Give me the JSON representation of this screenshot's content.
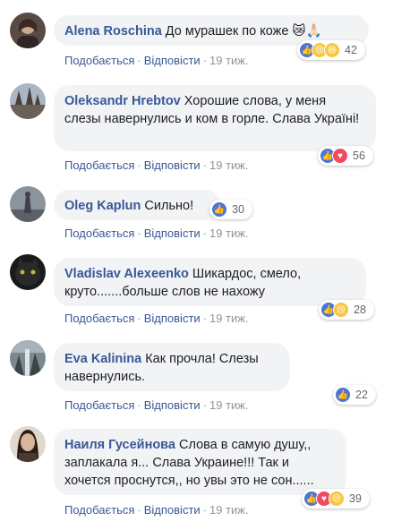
{
  "comments": [
    {
      "author": "Alena Roschina",
      "text": "До мурашек по коже 😿🙏🏻",
      "reactions": [
        "like",
        "sad",
        "haha"
      ],
      "count": "42",
      "like_label": "Подобається",
      "reply_label": "Відповісти",
      "time": "19 тиж."
    },
    {
      "author": "Oleksandr Hrebtov",
      "text": "Хорошие слова, у меня слезы навернулись и ком в горле. Слава Україні!",
      "reactions": [
        "like",
        "love"
      ],
      "count": "56",
      "like_label": "Подобається",
      "reply_label": "Відповісти",
      "time": "19 тиж."
    },
    {
      "author": "Oleg Kaplun",
      "text": "Сильно!",
      "reactions": [
        "like"
      ],
      "count": "30",
      "like_label": "Подобається",
      "reply_label": "Відповісти",
      "time": "19 тиж."
    },
    {
      "author": "Vladislav Alexeenko",
      "text": "Шикардос, смело, круто.......больше слов не нахожу",
      "reactions": [
        "like",
        "sad"
      ],
      "count": "28",
      "like_label": "Подобається",
      "reply_label": "Відповісти",
      "time": "19 тиж."
    },
    {
      "author": "Eva Kalinina",
      "text": "Как прочла! Слезы навернулись.",
      "reactions": [
        "like"
      ],
      "count": "22",
      "like_label": "Подобається",
      "reply_label": "Відповісти",
      "time": "19 тиж."
    },
    {
      "author": "Наиля Гусейнова",
      "text": "Слова в самую душу,, заплакала я... Слава Украине!!! Так и хочется проснутся,, но увы это не сон......",
      "reactions": [
        "like",
        "love",
        "sad"
      ],
      "count": "39",
      "like_label": "Подобається",
      "reply_label": "Відповісти",
      "time": "19 тиж."
    }
  ],
  "colors": {
    "author": "#385898",
    "bubble": "#f2f3f5",
    "meta": "#90949c",
    "like": "#4a76d8",
    "love": "#ef4a5e",
    "emoji": "#f7c642"
  }
}
